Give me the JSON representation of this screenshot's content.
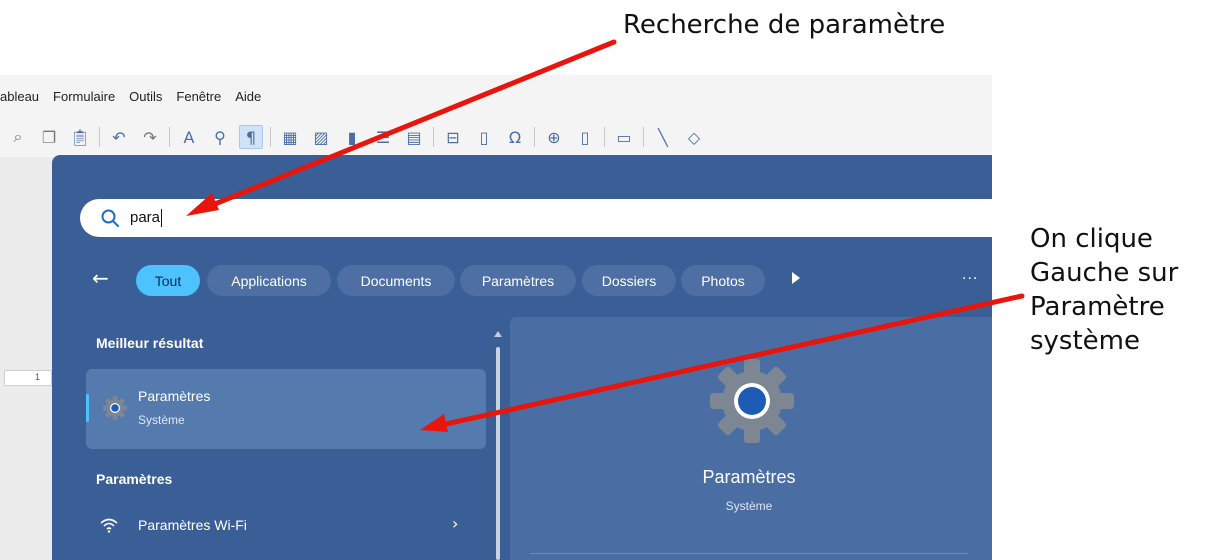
{
  "annotations": {
    "top_label": "Recherche de paramètre",
    "right_label_lines": [
      "On clique",
      "Gauche sur",
      "Paramètre",
      "système"
    ]
  },
  "writer": {
    "menu": [
      "ableau",
      "Formulaire",
      "Outils",
      "Fenêtre",
      "Aide"
    ],
    "ruler_mark": "1"
  },
  "search": {
    "query": "para",
    "filters": [
      "Tout",
      "Applications",
      "Documents",
      "Paramètres",
      "Dossiers",
      "Photos"
    ],
    "active_filter": "Tout",
    "more": "..."
  },
  "results": {
    "best_header": "Meilleur résultat",
    "best": {
      "name": "Paramètres",
      "category": "Système"
    },
    "settings_header": "Paramètres",
    "items": [
      {
        "label": "Paramètres Wi-Fi"
      }
    ]
  },
  "preview": {
    "name": "Paramètres",
    "category": "Système"
  },
  "colors": {
    "panel_bg": "#3a5e96",
    "accent": "#4cc2ff",
    "arrow": "#e8150c"
  },
  "icons": [
    "search-icon",
    "gear-icon",
    "wifi-icon",
    "chevron-right-icon",
    "back-arrow-icon"
  ]
}
